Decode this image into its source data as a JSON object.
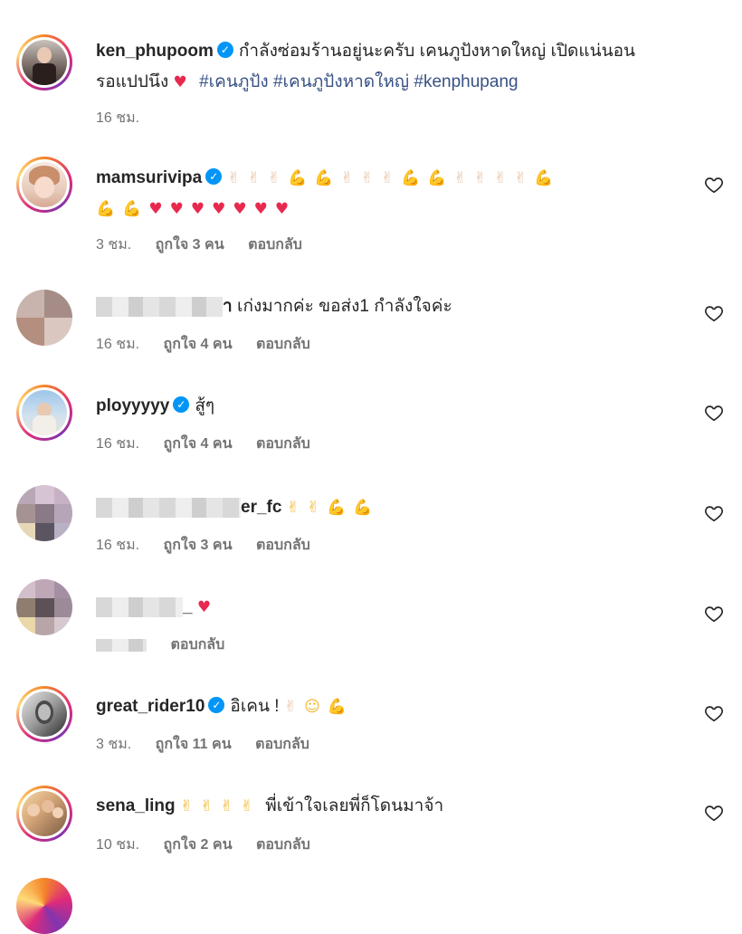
{
  "post": {
    "username": "ken_phupoom",
    "caption": "กำลังซ่อมร้านอยู่นะครับ เคนภูปังหาดใหญ่ เปิดแน่นอน",
    "caption_line2": "รอแปปนึง",
    "hashtags": [
      "#เคนภูปัง",
      "#เคนภูปังหาดใหญ่",
      "#kenphupang"
    ],
    "time": "16 ชม."
  },
  "comments": [
    {
      "username": "mamsurivipa",
      "verified": true,
      "time": "3 ชม.",
      "likes": "ถูกใจ 3 คน",
      "reply": "ตอบกลับ"
    },
    {
      "username": "",
      "username_suffix": "า",
      "text": "เก่งมากค่ะ ขอส่ง1 กำลังใจค่ะ",
      "time": "16 ชม.",
      "likes": "ถูกใจ 4 คน",
      "reply": "ตอบกลับ"
    },
    {
      "username": "ployyyyy",
      "verified": true,
      "text": "สู้ๆ",
      "time": "16 ชม.",
      "likes": "ถูกใจ 4 คน",
      "reply": "ตอบกลับ"
    },
    {
      "username": "",
      "username_suffix": "er_fc",
      "time": "16 ชม.",
      "likes": "ถูกใจ 3 คน",
      "reply": "ตอบกลับ"
    },
    {
      "username": "",
      "username_suffix": "_",
      "reply": "ตอบกลับ"
    },
    {
      "username": "great_rider10",
      "verified": true,
      "text": "อิเคน !",
      "time": "3 ชม.",
      "likes": "ถูกใจ 11 คน",
      "reply": "ตอบกลับ"
    },
    {
      "username": "sena_ling",
      "text": "พี่เข้าใจเลยพี่ก็โดนมาจ้า",
      "time": "10 ชม.",
      "likes": "ถูกใจ 2 คน",
      "reply": "ตอบกลับ"
    }
  ],
  "colors": {
    "verified": "#0095f6",
    "hashtag": "#385185",
    "heart": "#e8294f",
    "meta": "#737373"
  },
  "icons": {
    "like": "heart-outline-icon",
    "verified": "verified-badge-icon"
  }
}
